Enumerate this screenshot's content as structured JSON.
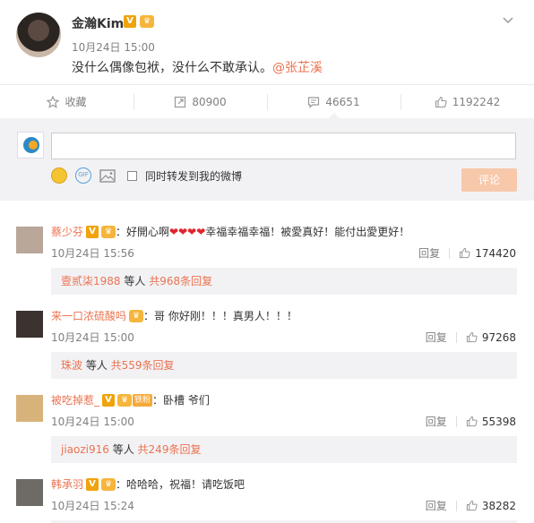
{
  "post": {
    "author": "金瀚Kim",
    "vip": "V",
    "crown": "♛",
    "time": "10月24日 15:00",
    "text": "没什么偶像包袱，没什么不敢承认。",
    "mention": "@张芷溪",
    "menu_icon": "chevron-down-icon"
  },
  "actions": {
    "fav_label": "收藏",
    "repost_count": "80900",
    "comment_count": "46651",
    "like_count": "1192242"
  },
  "compose": {
    "input_value": "",
    "emoji_icon": "smiley-icon",
    "gif_label": "GIF",
    "image_icon": "image-icon",
    "also_repost_label": "同时转发到我的微博",
    "submit_label": "评论"
  },
  "comments": [
    {
      "name": "蔡少芬",
      "badges": [
        "V",
        "♛"
      ],
      "text_before": "：好開心啊",
      "hearts": "❤❤❤❤",
      "text_after": "幸福幸福幸福！被愛真好！能付出愛更好！",
      "time": "10月24日 15:56",
      "reply_label": "回复",
      "likes": "174420",
      "sub_user": "壹贰柒1988",
      "sub_mid": " 等人 ",
      "sub_count": "共968条回复",
      "avatar_color": "#b9a79a"
    },
    {
      "name": "来一口浓硫酸吗",
      "badges": [
        "♛"
      ],
      "text_before": "：哥 你好刚！！！真男人！！！",
      "hearts": "",
      "text_after": "",
      "time": "10月24日 15:00",
      "reply_label": "回复",
      "likes": "97268",
      "sub_user": "珠波",
      "sub_mid": " 等人 ",
      "sub_count": "共559条回复",
      "avatar_color": "#3a3330"
    },
    {
      "name": "被吃掉惹_",
      "badges": [
        "V",
        "♛",
        "铁粉"
      ],
      "text_before": "：卧槽 爷们",
      "hearts": "",
      "text_after": "",
      "time": "10月24日 15:00",
      "reply_label": "回复",
      "likes": "55398",
      "sub_user": "jiaozi916",
      "sub_mid": " 等人 ",
      "sub_count": "共249条回复",
      "avatar_color": "#d7b37b"
    },
    {
      "name": "韩承羽",
      "badges": [
        "V",
        "♛"
      ],
      "text_before": "：哈哈哈，祝福！请吃饭吧",
      "hearts": "",
      "text_after": "",
      "time": "10月24日 15:24",
      "reply_label": "回复",
      "likes": "38282",
      "sub_user": "",
      "sub_mid": "",
      "sub_count": "",
      "avatar_color": "#6e6a66"
    }
  ]
}
